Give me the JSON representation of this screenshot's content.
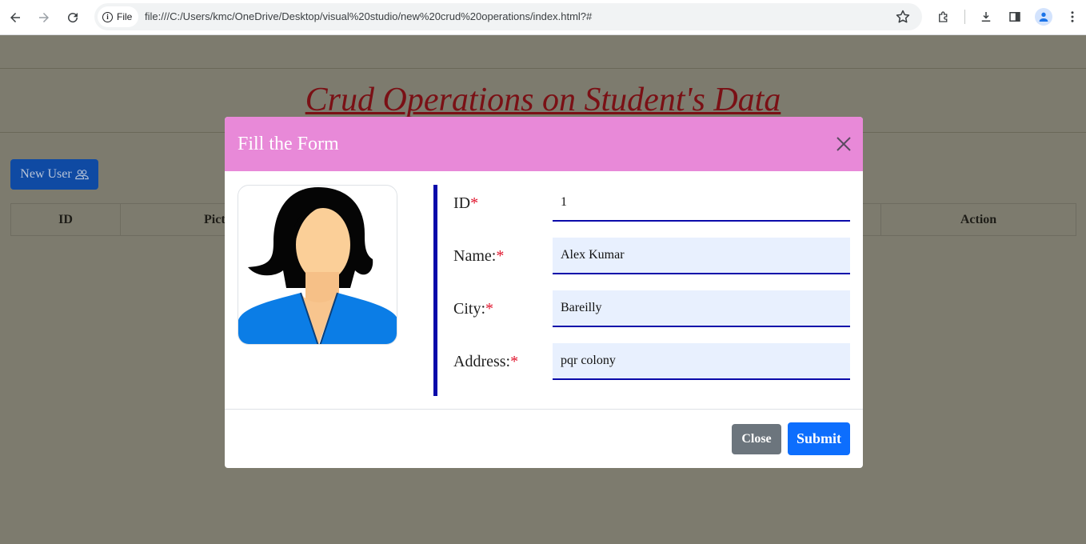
{
  "browser": {
    "scheme_label": "File",
    "url": "file:///C:/Users/kmc/OneDrive/Desktop/visual%20studio/new%20crud%20operations/index.html?#"
  },
  "page": {
    "title": "Crud Operations on Student's Data",
    "new_user_label": "New User",
    "table_headers": [
      "ID",
      "Pict",
      "",
      "Action"
    ]
  },
  "modal": {
    "title": "Fill the Form",
    "required_mark": "*",
    "fields": [
      {
        "label": "ID",
        "value": "1"
      },
      {
        "label": "Name:",
        "value": "Alex Kumar"
      },
      {
        "label": "City:",
        "value": "Bareilly"
      },
      {
        "label": "Address:",
        "value": "pqr colony"
      }
    ],
    "close_label": "Close",
    "submit_label": "Submit"
  },
  "colors": {
    "overlay_bg": "#7d7b6e",
    "modal_header": "#e889d8",
    "title_red": "#7a1015",
    "accent_blue": "#0a0aaa",
    "submit": "#0d6efd",
    "close": "#6c757d"
  }
}
